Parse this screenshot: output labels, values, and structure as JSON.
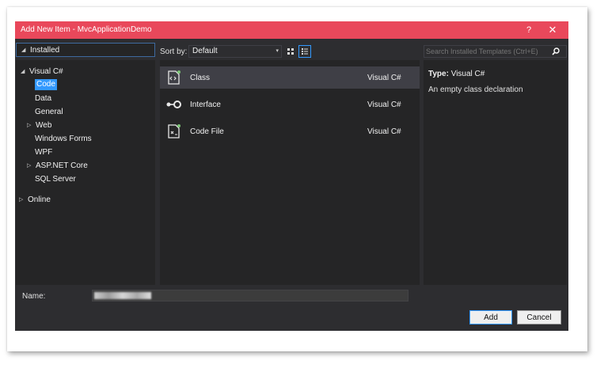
{
  "dialog": {
    "title": "Add New Item - MvcApplicationDemo",
    "help_glyph": "?",
    "close_glyph": "✕"
  },
  "sidebar": {
    "header": "Installed",
    "tree": [
      {
        "label": "Visual C#",
        "indent": 0,
        "arrow": "◢",
        "selected": false
      },
      {
        "label": "Code",
        "indent": 1,
        "arrow": "",
        "selected": true
      },
      {
        "label": "Data",
        "indent": 1,
        "arrow": "",
        "selected": false
      },
      {
        "label": "General",
        "indent": 1,
        "arrow": "",
        "selected": false
      },
      {
        "label": "Web",
        "indent": 1,
        "arrow": "▷",
        "selected": false
      },
      {
        "label": "Windows Forms",
        "indent": 1,
        "arrow": "",
        "selected": false
      },
      {
        "label": "WPF",
        "indent": 1,
        "arrow": "",
        "selected": false
      },
      {
        "label": "ASP.NET Core",
        "indent": 1,
        "arrow": "▷",
        "selected": false
      },
      {
        "label": "SQL Server",
        "indent": 1,
        "arrow": "",
        "selected": false
      },
      {
        "label": "Online",
        "indent": 0,
        "arrow": "▷",
        "selected": false
      }
    ]
  },
  "sort": {
    "label": "Sort by:",
    "value": "Default"
  },
  "templates": [
    {
      "name": "Class",
      "language": "Visual C#",
      "icon": "class-file-icon",
      "selected": true
    },
    {
      "name": "Interface",
      "language": "Visual C#",
      "icon": "interface-icon",
      "selected": false
    },
    {
      "name": "Code File",
      "language": "Visual C#",
      "icon": "code-file-icon",
      "selected": false
    }
  ],
  "search": {
    "placeholder": "Search Installed Templates (Ctrl+E)"
  },
  "details": {
    "type_label": "Type:",
    "type_value": "Visual C#",
    "description": "An empty class declaration"
  },
  "name_field": {
    "label": "Name:"
  },
  "buttons": {
    "add": "Add",
    "cancel": "Cancel"
  },
  "colors": {
    "titlebar": "#e9485b",
    "accent": "#3399ff",
    "panel": "#252526",
    "dialog": "#2d2d30"
  }
}
